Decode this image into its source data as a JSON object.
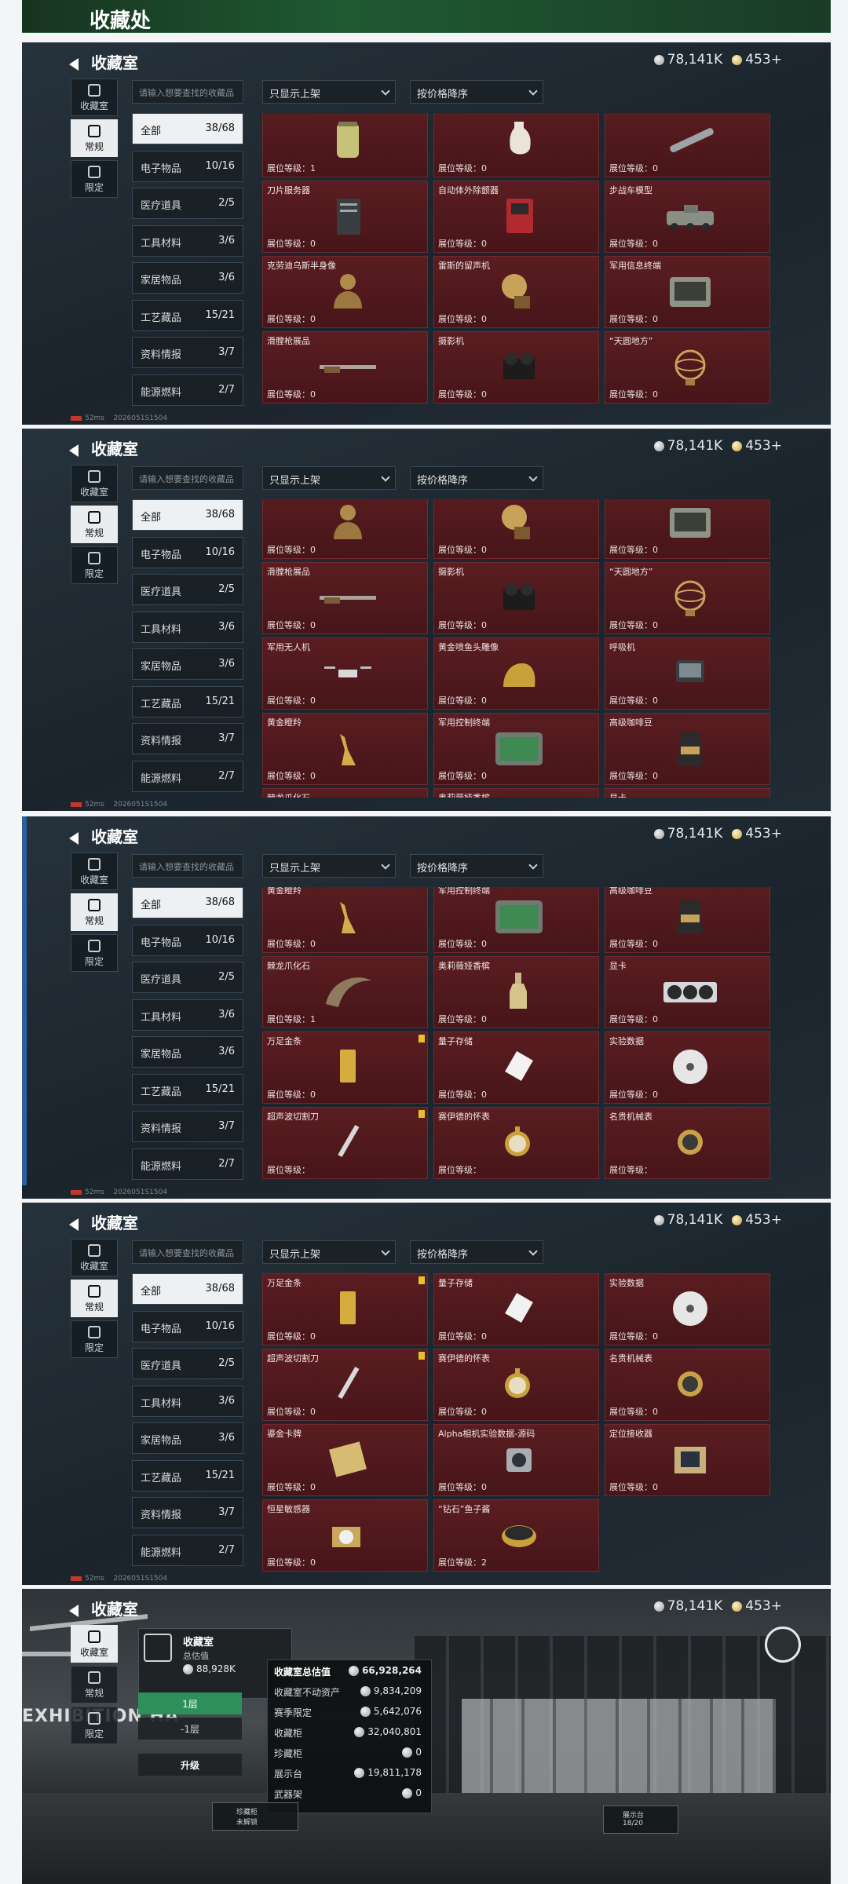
{
  "app_title": "收藏处",
  "header": {
    "title": "收藏室",
    "currency1": "78,141K",
    "currency2": "453+"
  },
  "left_nav": [
    {
      "label": "收藏室",
      "icon": "vault-icon"
    },
    {
      "label": "常规",
      "icon": "regular-icon"
    },
    {
      "label": "限定",
      "icon": "limited-icon"
    }
  ],
  "search_placeholder": "请输入想要查找的收藏品",
  "filter_select": "只显示上架",
  "sort_select": "按价格降序",
  "categories": [
    {
      "label": "全部",
      "count": "38/68"
    },
    {
      "label": "电子物品",
      "count": "10/16"
    },
    {
      "label": "医疗道具",
      "count": "2/5"
    },
    {
      "label": "工具材料",
      "count": "3/6"
    },
    {
      "label": "家居物品",
      "count": "3/6"
    },
    {
      "label": "工艺藏品",
      "count": "15/21"
    },
    {
      "label": "资料情报",
      "count": "3/7"
    },
    {
      "label": "能源燃料",
      "count": "2/7"
    }
  ],
  "status_text": "52ms",
  "build_id": "2026051S1504",
  "level_label": "展位等级：",
  "panels": [
    {
      "items": [
        {
          "name": "",
          "level": "1",
          "art": "jar"
        },
        {
          "name": "",
          "level": "0",
          "art": "vase"
        },
        {
          "name": "",
          "level": "0",
          "art": "pen"
        },
        {
          "name": "刀片服务器",
          "level": "0",
          "art": "server"
        },
        {
          "name": "自动体外除颤器",
          "level": "0",
          "art": "aed"
        },
        {
          "name": "步战车模型",
          "level": "0",
          "art": "ifv"
        },
        {
          "name": "克劳迪乌斯半身像",
          "level": "0",
          "art": "bust"
        },
        {
          "name": "雷斯的留声机",
          "level": "0",
          "art": "phono"
        },
        {
          "name": "军用信息终端",
          "level": "0",
          "art": "case"
        },
        {
          "name": "滑膛枪展品",
          "level": "0",
          "art": "musket"
        },
        {
          "name": "摄影机",
          "level": "0",
          "art": "camera"
        },
        {
          "name": "“天圆地方”",
          "level": "0",
          "art": "sphere"
        }
      ]
    },
    {
      "items": [
        {
          "name": "",
          "level": "0",
          "art": "bust"
        },
        {
          "name": "",
          "level": "0",
          "art": "phono"
        },
        {
          "name": "",
          "level": "0",
          "art": "case"
        },
        {
          "name": "滑膛枪展品",
          "level": "0",
          "art": "musket"
        },
        {
          "name": "摄影机",
          "level": "0",
          "art": "camera"
        },
        {
          "name": "“天圆地方”",
          "level": "0",
          "art": "sphere"
        },
        {
          "name": "军用无人机",
          "level": "0",
          "art": "drone"
        },
        {
          "name": "黄金喷鱼头雕像",
          "level": "0",
          "art": "statue"
        },
        {
          "name": "呼吸机",
          "level": "0",
          "art": "monitor"
        },
        {
          "name": "黄金瞪羚",
          "level": "0",
          "art": "gazelle"
        },
        {
          "name": "军用控制终端",
          "level": "0",
          "art": "terminal"
        },
        {
          "name": "高级咖啡豆",
          "level": "0",
          "art": "coffee"
        },
        {
          "name": "棘龙爪化石",
          "level": "",
          "art": "claw"
        },
        {
          "name": "奥莉薇娅香槟",
          "level": "",
          "art": "bottle"
        },
        {
          "name": "显卡",
          "level": "",
          "art": "gpu"
        }
      ]
    },
    {
      "items": [
        {
          "name": "黄金瞪羚",
          "level": "0",
          "art": "gazelle"
        },
        {
          "name": "军用控制终端",
          "level": "0",
          "art": "terminal"
        },
        {
          "name": "高级咖啡豆",
          "level": "0",
          "art": "coffee"
        },
        {
          "name": "棘龙爪化石",
          "level": "1",
          "art": "claw"
        },
        {
          "name": "奥莉薇娅香槟",
          "level": "0",
          "art": "bottle"
        },
        {
          "name": "显卡",
          "level": "0",
          "art": "gpu"
        },
        {
          "name": "万足金条",
          "level": "0",
          "art": "gold",
          "flag": true
        },
        {
          "name": "量子存储",
          "level": "0",
          "art": "usb"
        },
        {
          "name": "实验数据",
          "level": "0",
          "art": "disc"
        },
        {
          "name": "超声波切割刀",
          "level": "",
          "art": "knife",
          "flag": true
        },
        {
          "name": "赛伊德的怀表",
          "level": "",
          "art": "watch"
        },
        {
          "name": "名贵机械表",
          "level": "",
          "art": "wrist"
        }
      ]
    },
    {
      "items": [
        {
          "name": "万足金条",
          "level": "0",
          "art": "gold",
          "flag": true
        },
        {
          "name": "量子存储",
          "level": "0",
          "art": "usb"
        },
        {
          "name": "实验数据",
          "level": "0",
          "art": "disc"
        },
        {
          "name": "超声波切割刀",
          "level": "0",
          "art": "knife",
          "flag": true
        },
        {
          "name": "赛伊德的怀表",
          "level": "0",
          "art": "watch"
        },
        {
          "name": "名贵机械表",
          "level": "0",
          "art": "wrist"
        },
        {
          "name": "鎏金卡牌",
          "level": "0",
          "art": "card"
        },
        {
          "name": "Alpha相机实验数据-源码",
          "level": "0",
          "art": "lens"
        },
        {
          "name": "定位接收器",
          "level": "0",
          "art": "receiver"
        },
        {
          "name": "恒星敏感器",
          "level": "0",
          "art": "sensor"
        },
        {
          "name": "“钻石”鱼子酱",
          "level": "2",
          "art": "caviar"
        }
      ]
    }
  ],
  "hall": {
    "card_title": "收藏室",
    "card_sub": "总估值",
    "card_value": "88,928K",
    "floor1": "1层",
    "floor2": "-1层",
    "upgrade": "升级",
    "sign_text": "EXHIBITION HA",
    "valuation": [
      {
        "label": "收藏室总估值",
        "value": "66,928,264"
      },
      {
        "label": "收藏室不动资产",
        "value": "9,834,209"
      },
      {
        "label": "赛季限定",
        "value": "5,642,076"
      },
      {
        "label": "收藏柜",
        "value": "32,040,801"
      },
      {
        "label": "珍藏柜",
        "value": "0"
      },
      {
        "label": "展示台",
        "value": "19,811,178"
      },
      {
        "label": "武器架",
        "value": "0"
      }
    ],
    "bottom_left_1": "珍藏柜",
    "bottom_left_2": "未解锁",
    "bottom_right_1": "展示台",
    "bottom_right_2": "18/20"
  }
}
